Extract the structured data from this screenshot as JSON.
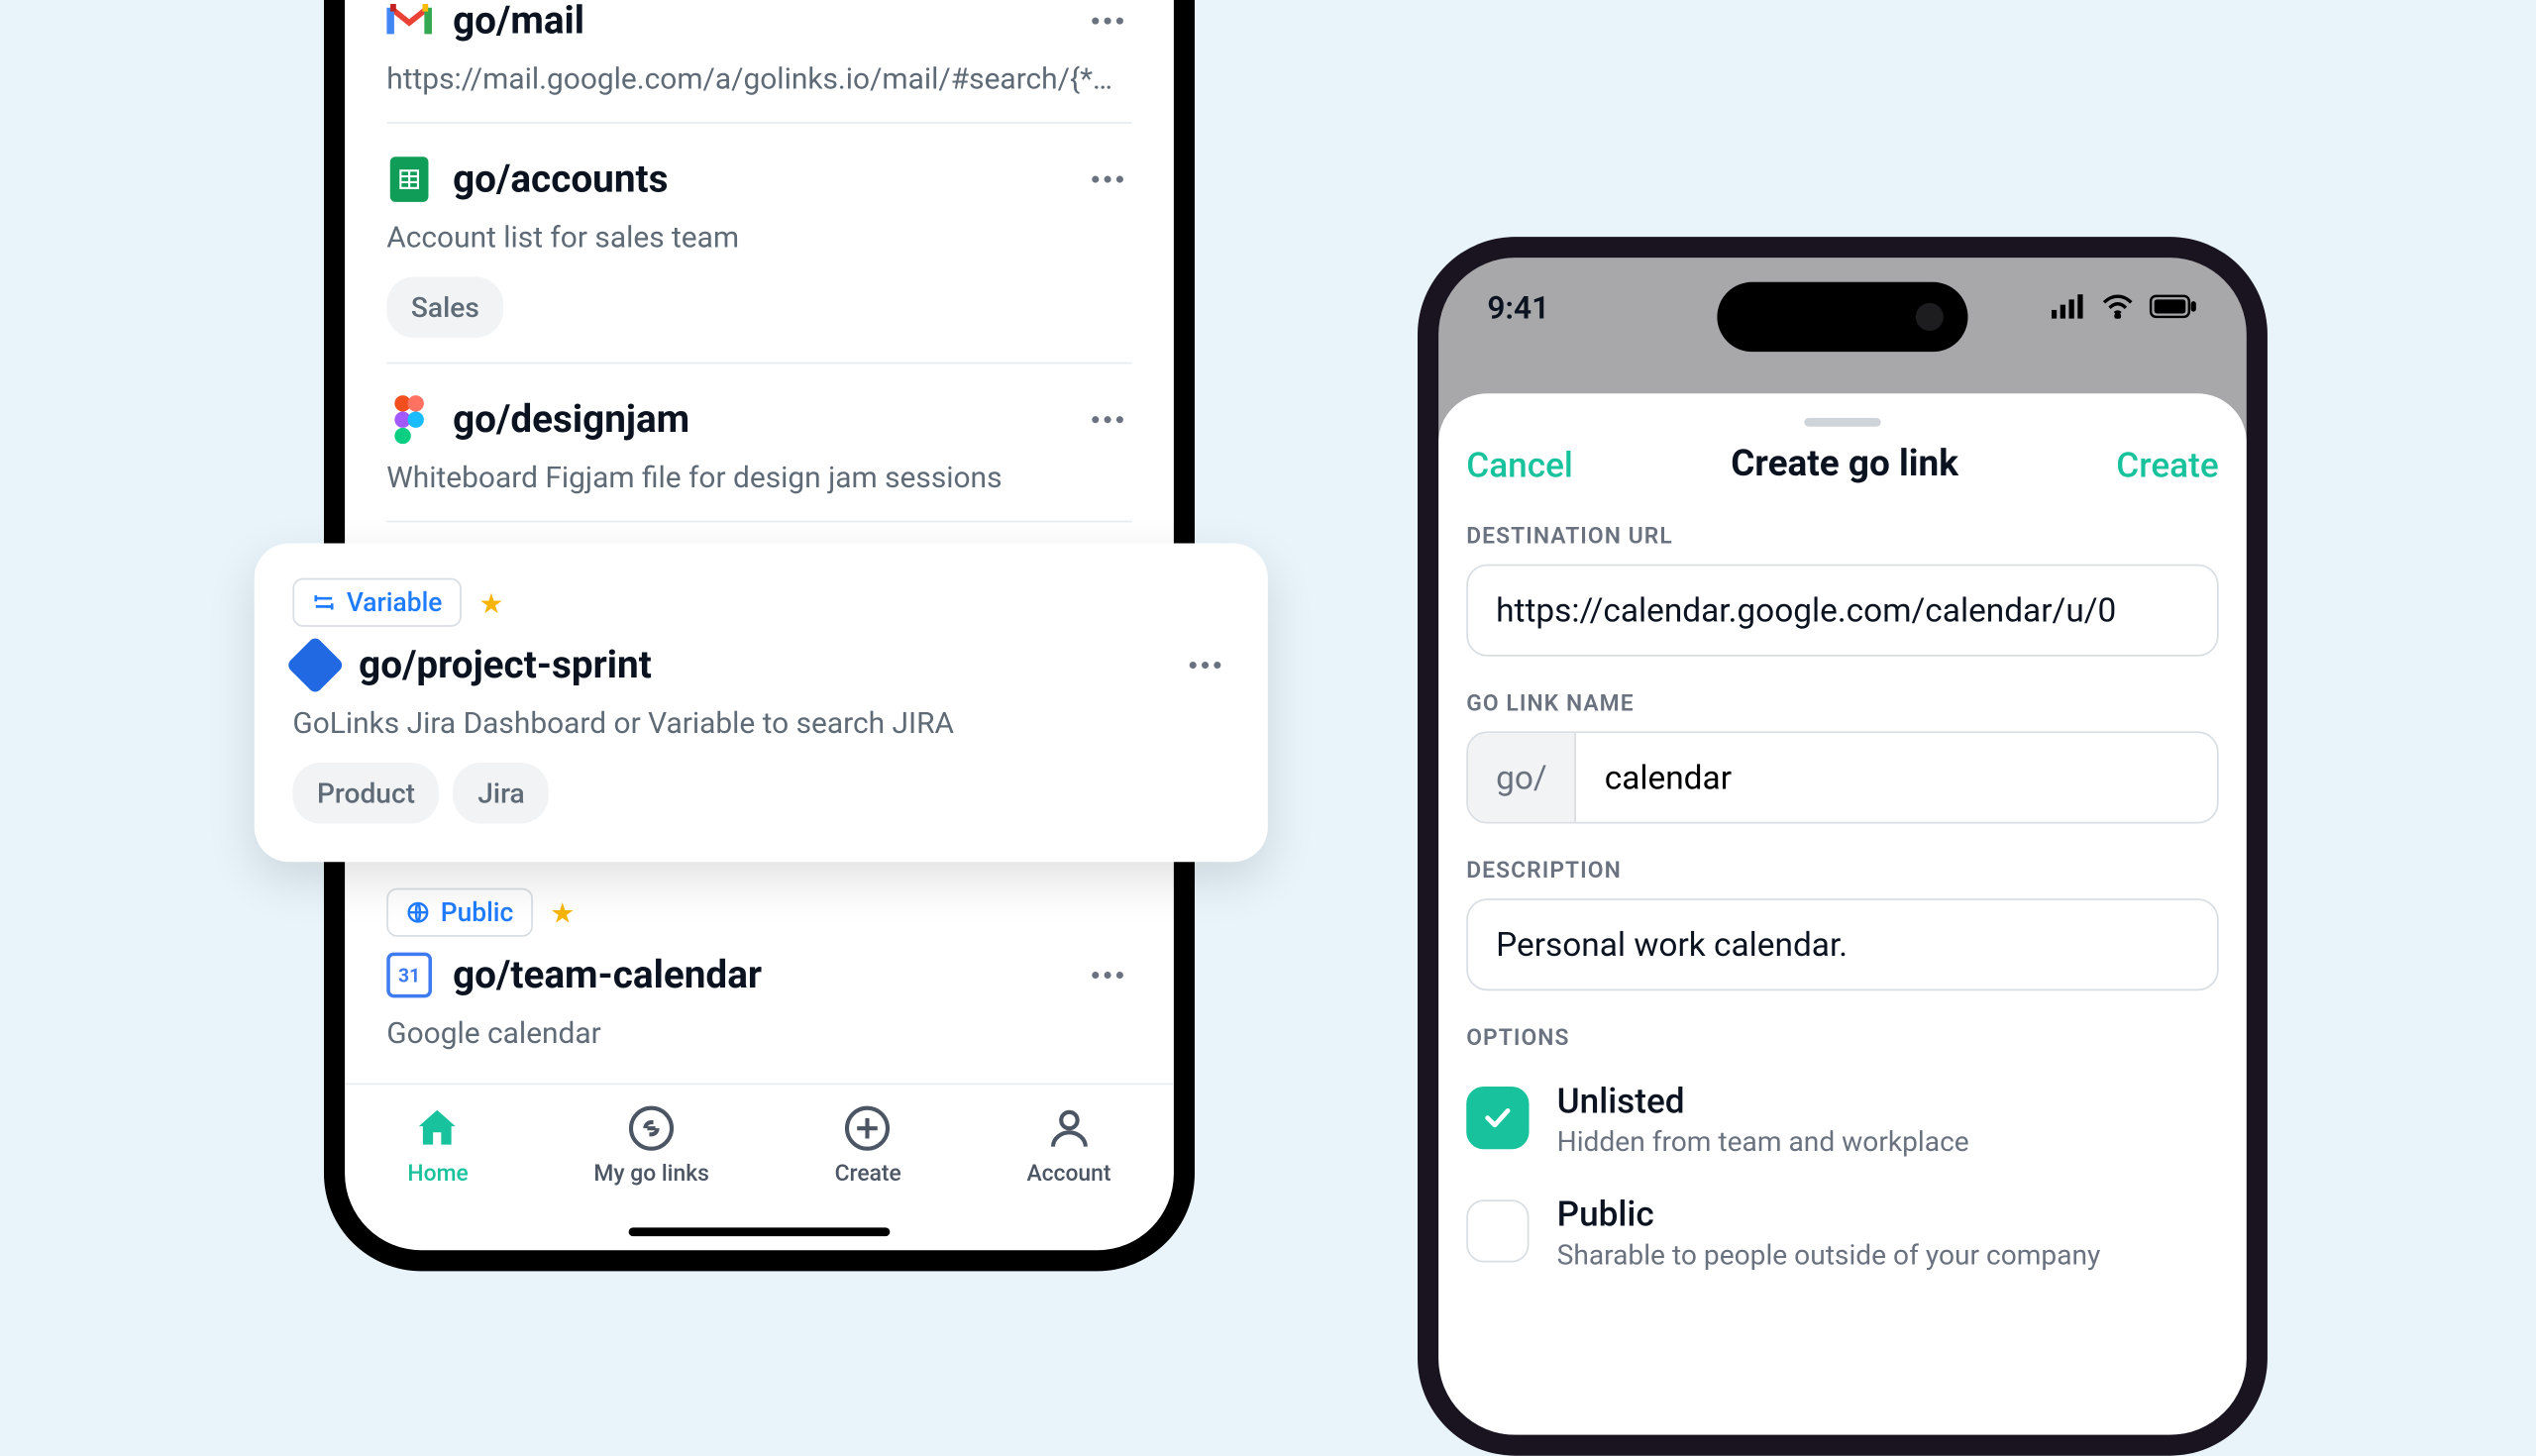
{
  "left": {
    "rows": [
      {
        "title": "go/mail",
        "sub": "https://mail.google.com/a/golinks.io/mail/#search/{*…"
      },
      {
        "title": "go/accounts",
        "sub": "Account list for sales team",
        "tag": "Sales"
      },
      {
        "title": "go/designjam",
        "sub": "Whiteboard Figjam file for design jam sessions"
      },
      {
        "title": "go/team-calendar",
        "sub": "Google calendar",
        "badge": "Public"
      }
    ],
    "tabs": {
      "home": "Home",
      "mylinks": "My go links",
      "create": "Create",
      "account": "Account"
    }
  },
  "float": {
    "badge": "Variable",
    "title": "go/project-sprint",
    "sub": "GoLinks Jira Dashboard or Variable to search JIRA",
    "tag1": "Product",
    "tag2": "Jira"
  },
  "right": {
    "time": "9:41",
    "cancel": "Cancel",
    "title": "Create go link",
    "create": "Create",
    "labels": {
      "dest": "DESTINATION URL",
      "name": "GO LINK NAME",
      "desc": "DESCRIPTION",
      "opts": "OPTIONS"
    },
    "dest": "https://calendar.google.com/calendar/u/0",
    "prefix": "go/",
    "name": "calendar",
    "desc": "Personal work calendar.",
    "opt1": {
      "title": "Unlisted",
      "sub": "Hidden from team and workplace"
    },
    "opt2": {
      "title": "Public",
      "sub": "Sharable to people outside of your company"
    }
  }
}
